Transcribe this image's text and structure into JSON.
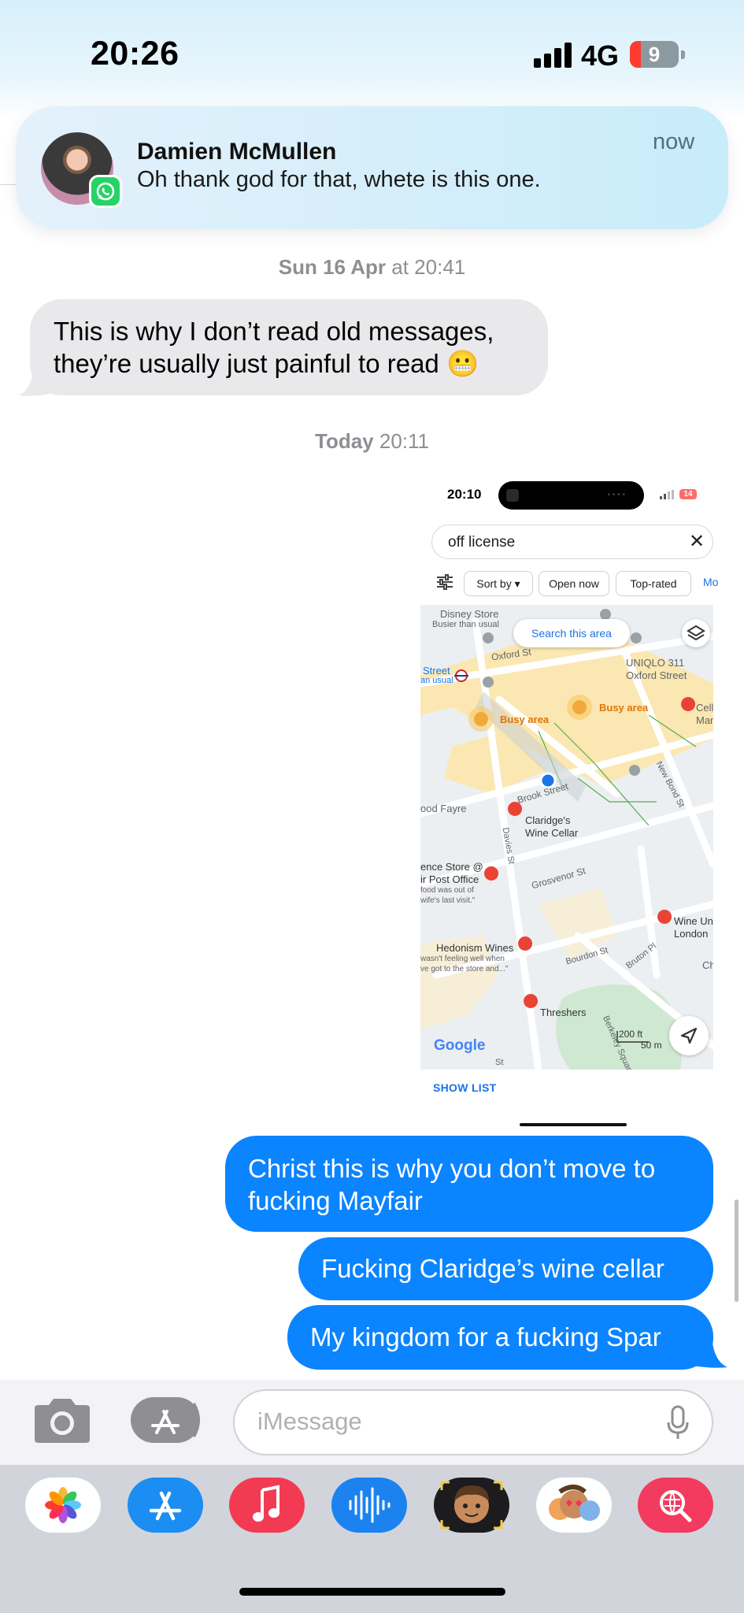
{
  "status": {
    "time": "20:26",
    "network": "4G",
    "battery": "9"
  },
  "notification": {
    "sender": "Damien McMullen",
    "message": "Oh thank god for that, whete is this one.",
    "time": "now",
    "app_icon": "whatsapp-icon"
  },
  "thread": {
    "stamp1_day": "Sun 16 Apr",
    "stamp1_time": " at 20:41",
    "incoming": "This is why I don’t read old messages, they’re usually just painful to read 😬",
    "stamp2_day": "Today",
    "stamp2_time": " 20:11",
    "outgoing": [
      "Christ this is why you don’t move to fucking Mayfair",
      "Fucking Claridge’s wine cellar",
      "My kingdom for a fucking Spar"
    ]
  },
  "screenshot": {
    "time": "20:10",
    "battery": "14",
    "search": "off license",
    "chips": [
      "Sort by ▾",
      "Open now",
      "Top-rated"
    ],
    "chip_more": "Mo",
    "search_area": "Search this area",
    "labels": {
      "disney": "Disney Store",
      "disney_sub": "Busier than usual",
      "oxford_st": "Oxford St",
      "street": "Street",
      "street_sub": "an usual",
      "uniqlo": "UNIQLO 311",
      "uniqlo_sub": "Oxford Street",
      "busy1": "Busy area",
      "busy2": "Busy area",
      "cell": "Cell",
      "cell_sub": "Mar",
      "food": "ood Fayre",
      "brook": "Brook Street",
      "claridges": "Claridge's",
      "claridges_sub": "Wine Cellar",
      "davies": "Davies St",
      "newbond": "New Bond St",
      "essence": "ence Store @",
      "essence2": "ir Post Office",
      "essence3": "food was out of",
      "essence4": "wife's last visit.\"",
      "grosvenor": "Grosvenor St",
      "wineun": "Wine Un",
      "wineun_sub": "London",
      "hedonism": "Hedonism Wines",
      "hedonism2": "wasn't feeling well when",
      "hedonism3": "ve got to the store and...\"",
      "bourdon": "Bourdon St",
      "bruton": "Bruton Pl",
      "ch": "Ch",
      "threshers": "Threshers",
      "berkeley": "Berkeley Square",
      "st": "St"
    },
    "google": "Google",
    "scale_ft": "200 ft",
    "scale_m": "50 m",
    "show_list": "SHOW LIST"
  },
  "input": {
    "placeholder": "iMessage"
  },
  "drawer": {
    "apps": [
      "photos-app-icon",
      "app-store-icon",
      "music-app-icon",
      "audio-messages-icon",
      "memoji-icon",
      "memoji-stickers-icon",
      "web-search-icon"
    ]
  },
  "colors": {
    "imessage_blue": "#0b84ff",
    "incoming_gray": "#e9e9eb",
    "whatsapp_green": "#25d366",
    "maps_busy": "#f7c65b"
  }
}
